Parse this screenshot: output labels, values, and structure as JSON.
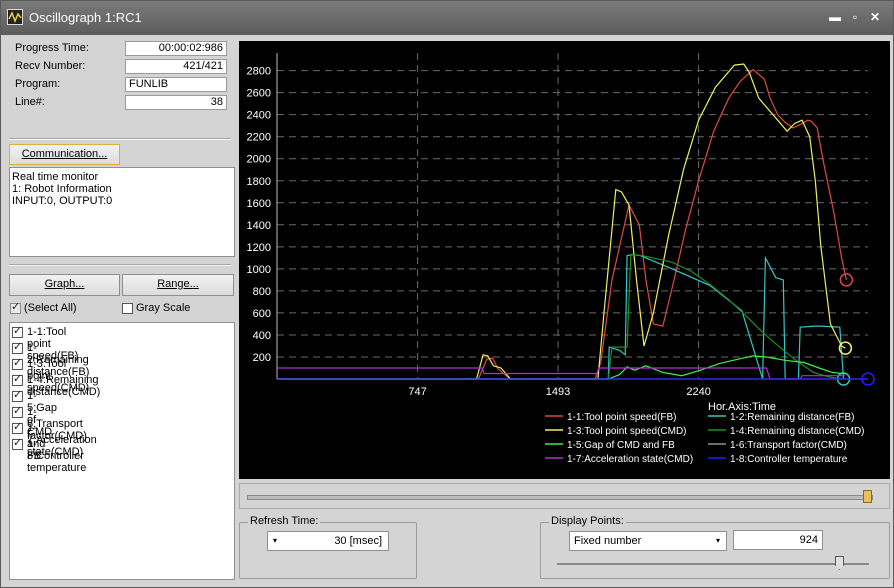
{
  "window": {
    "title": "Oscillograph 1:RC1",
    "minimize_glyph": "▬",
    "restore_glyph": "▫",
    "close_glyph": "✕"
  },
  "status": {
    "progress_time_label": "Progress Time:",
    "progress_time_value": "00:00:02:986",
    "recv_number_label": "Recv Number:",
    "recv_number_value": "421/421",
    "program_label": "Program:",
    "program_value": "FUNLIB",
    "line_label": "Line#:",
    "line_value": "38"
  },
  "communication_button": "Communication...",
  "monitor_lines": [
    "Real time monitor",
    "1: Robot Information",
    "INPUT:0, OUTPUT:0"
  ],
  "graph_button": "Graph...",
  "range_button": "Range...",
  "select_all_label": "(Select All)",
  "gray_scale_label": "Gray Scale",
  "signals": [
    {
      "label": "1-1:Tool point speed(FB)",
      "checked": true
    },
    {
      "label": "1-2:Remaining distance(FB)",
      "checked": true
    },
    {
      "label": "1-3:Tool point speed(CMD)",
      "checked": true
    },
    {
      "label": "1-4:Remaining distance(CMD)",
      "checked": true
    },
    {
      "label": "1-5:Gap of CMD and FB",
      "checked": true
    },
    {
      "label": "1-6:Transport factor(CMD)",
      "checked": true
    },
    {
      "label": "1-7:Acceleration state(CMD)",
      "checked": true
    },
    {
      "label": "1-8:Controller temperature",
      "checked": true
    }
  ],
  "refresh": {
    "title": "Refresh Time:",
    "value": "30 [msec]"
  },
  "display_points": {
    "title": "Display Points:",
    "mode": "Fixed number",
    "value": "924"
  },
  "chart_data": {
    "type": "line",
    "xlabel": "Hor.Axis:Time",
    "x_ticks": [
      747,
      1493,
      2240
    ],
    "y_ticks": [
      200,
      400,
      600,
      800,
      1000,
      1200,
      1400,
      1600,
      1800,
      2000,
      2200,
      2400,
      2600,
      2800
    ],
    "xlim": [
      0,
      3140
    ],
    "ylim": [
      0,
      2960
    ],
    "grid": true,
    "legend_position": "bottom-right",
    "series": [
      {
        "name": "1-1:Tool point speed(FB)",
        "color": "#e04848",
        "x": [
          0,
          1070,
          1115,
          1145,
          1175,
          1240,
          1490,
          1690,
          1720,
          1780,
          1870,
          1925,
          1960,
          2000,
          2050,
          2110,
          2170,
          2240,
          2320,
          2400,
          2460,
          2530,
          2590,
          2620,
          2660,
          2700,
          2740,
          2780,
          2820,
          2840,
          2870,
          2900,
          2960,
          3000,
          3025
        ],
        "y": [
          0,
          0,
          180,
          190,
          90,
          0,
          0,
          0,
          150,
          900,
          1580,
          1400,
          900,
          500,
          480,
          900,
          1350,
          1800,
          2250,
          2550,
          2700,
          2810,
          2720,
          2550,
          2400,
          2330,
          2280,
          2310,
          2350,
          2340,
          2280,
          2000,
          1500,
          1100,
          900
        ]
      },
      {
        "name": "1-2:Remaining distance(FB)",
        "color": "#30c8c8",
        "x": [
          0,
          1760,
          1765,
          1820,
          1850,
          1860,
          1890,
          1930,
          2100,
          2300,
          2470,
          2580,
          2595,
          2650,
          2690,
          2700,
          2770,
          2780,
          2860,
          2890,
          2990,
          3010
        ],
        "y": [
          0,
          0,
          290,
          260,
          220,
          1120,
          1130,
          1120,
          1000,
          850,
          620,
          0,
          1100,
          920,
          900,
          0,
          0,
          470,
          480,
          480,
          470,
          0
        ]
      },
      {
        "name": "1-3:Tool point speed(CMD)",
        "color": "#f0f060",
        "x": [
          0,
          1060,
          1095,
          1120,
          1150,
          1190,
          1240,
          1490,
          1705,
          1740,
          1800,
          1830,
          1870,
          1910,
          1950,
          2000,
          2080,
          2160,
          2240,
          2330,
          2430,
          2480,
          2510,
          2560,
          2620,
          2660,
          2710,
          2750,
          2790,
          2830,
          2860,
          2890,
          2940,
          3000,
          3020
        ],
        "y": [
          0,
          0,
          220,
          210,
          120,
          100,
          0,
          0,
          0,
          650,
          1720,
          1700,
          1580,
          900,
          300,
          600,
          1300,
          1900,
          2350,
          2650,
          2850,
          2860,
          2780,
          2550,
          2430,
          2350,
          2250,
          2320,
          2350,
          2200,
          1800,
          1200,
          500,
          300,
          280
        ]
      },
      {
        "name": "1-4:Remaining distance(CMD)",
        "color": "#208f20",
        "x": [
          0,
          1760,
          1780,
          1860,
          1880,
          1940,
          2000,
          2100,
          2200,
          2300,
          2400,
          2500,
          2570,
          2650,
          2750,
          2850,
          2930,
          3000,
          3010
        ],
        "y": [
          0,
          0,
          290,
          290,
          1130,
          1120,
          1100,
          1060,
          980,
          860,
          720,
          560,
          440,
          320,
          180,
          60,
          20,
          0,
          0
        ]
      },
      {
        "name": "1-5:Gap of CMD and FB",
        "color": "#40f040",
        "x": [
          0,
          1760,
          1820,
          1860,
          1900,
          1960,
          2050,
          2150,
          2250,
          2350,
          2450,
          2530,
          2600,
          2700,
          2800,
          2880,
          2950,
          3000,
          3020
        ],
        "y": [
          0,
          0,
          40,
          110,
          80,
          120,
          60,
          30,
          80,
          140,
          180,
          210,
          200,
          170,
          150,
          100,
          60,
          50,
          50
        ]
      },
      {
        "name": "1-6:Transport factor(CMD)",
        "color": "#909090",
        "x": [
          0,
          1700,
          1760,
          3140
        ],
        "y": [
          0,
          0,
          0,
          0
        ]
      },
      {
        "name": "1-7:Acceleration state(CMD)",
        "color": "#b030d0",
        "x": [
          0,
          1090,
          1100,
          1700,
          1710,
          2600,
          2620,
          2780,
          2790,
          3020
        ],
        "y": [
          100,
          100,
          50,
          50,
          100,
          100,
          0,
          0,
          30,
          30
        ]
      },
      {
        "name": "1-8:Controller temperature",
        "color": "#2020ff",
        "x": [
          0,
          3140
        ],
        "y": [
          0,
          0
        ]
      }
    ]
  }
}
